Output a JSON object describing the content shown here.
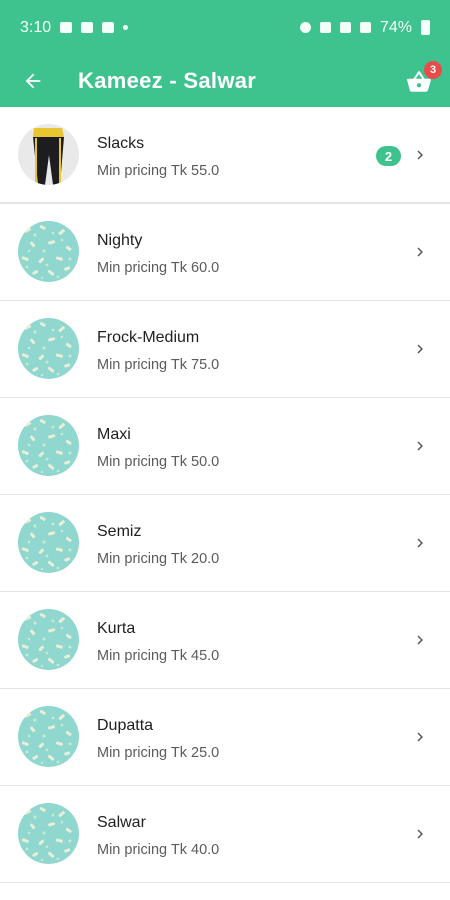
{
  "status_bar": {
    "time": "3:10",
    "battery": "74%"
  },
  "header": {
    "title": "Kameez - Salwar",
    "cart_count": "3"
  },
  "items": [
    {
      "name": "Slacks",
      "price": "Min pricing Tk 55.0",
      "count": "2",
      "photo": true
    },
    {
      "name": "Nighty",
      "price": "Min pricing Tk 60.0"
    },
    {
      "name": "Frock-Medium",
      "price": "Min pricing Tk 75.0"
    },
    {
      "name": "Maxi",
      "price": "Min pricing Tk 50.0"
    },
    {
      "name": "Semiz",
      "price": "Min pricing Tk 20.0"
    },
    {
      "name": "Kurta",
      "price": "Min pricing Tk 45.0"
    },
    {
      "name": "Dupatta",
      "price": "Min pricing Tk 25.0"
    },
    {
      "name": "Salwar",
      "price": "Min pricing Tk 40.0"
    }
  ],
  "colors": {
    "primary": "#3ec38f",
    "badge_red": "#e94b4b",
    "placeholder_bg": "#8fd7cf"
  }
}
